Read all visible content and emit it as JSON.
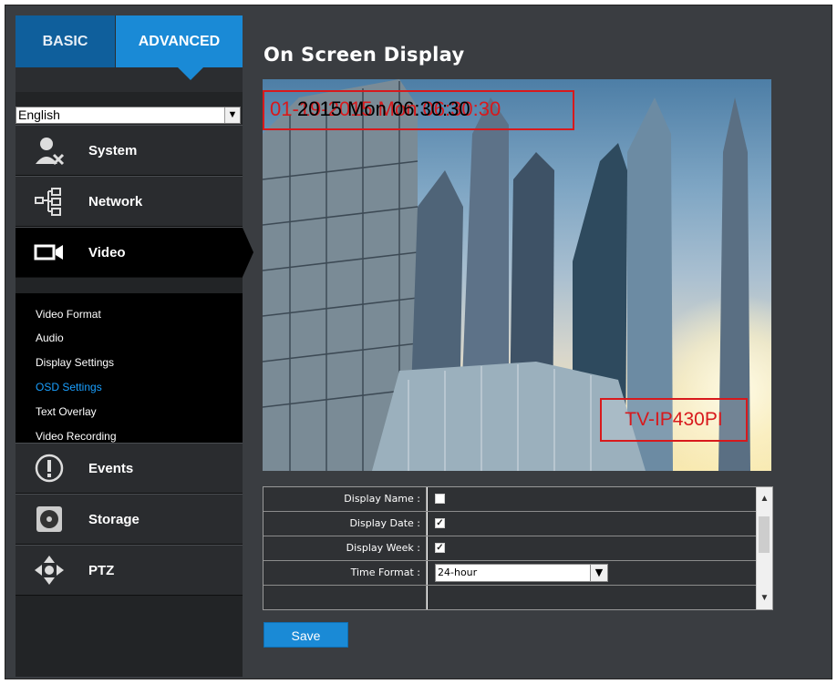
{
  "tabs": {
    "basic": "BASIC",
    "advanced": "ADVANCED"
  },
  "language": {
    "selected": "English"
  },
  "menu": {
    "system": "System",
    "network": "Network",
    "video": "Video",
    "events": "Events",
    "storage": "Storage",
    "ptz": "PTZ"
  },
  "video_submenu": [
    "Video Format",
    "Audio",
    "Display Settings",
    "OSD Settings",
    "Text Overlay",
    "Video Recording"
  ],
  "active_submenu": "OSD Settings",
  "page": {
    "title": "On Screen Display"
  },
  "preview": {
    "osd_date_red": "01-19-2015 Mon 06:30:30",
    "osd_date_black": "2015 Mon 06:30:30",
    "osd_name": "TV-IP430PI"
  },
  "settings": {
    "display_name_label": "Display Name :",
    "display_name_checked": false,
    "display_date_label": "Display Date :",
    "display_date_checked": true,
    "display_week_label": "Display Week :",
    "display_week_checked": true,
    "time_format_label": "Time Format :",
    "time_format_value": "24-hour"
  },
  "save_label": "Save",
  "colors": {
    "accent": "#1a8ad6",
    "osd_red": "#d8191c",
    "sidebar": "#222426",
    "background": "#3a3d41"
  }
}
